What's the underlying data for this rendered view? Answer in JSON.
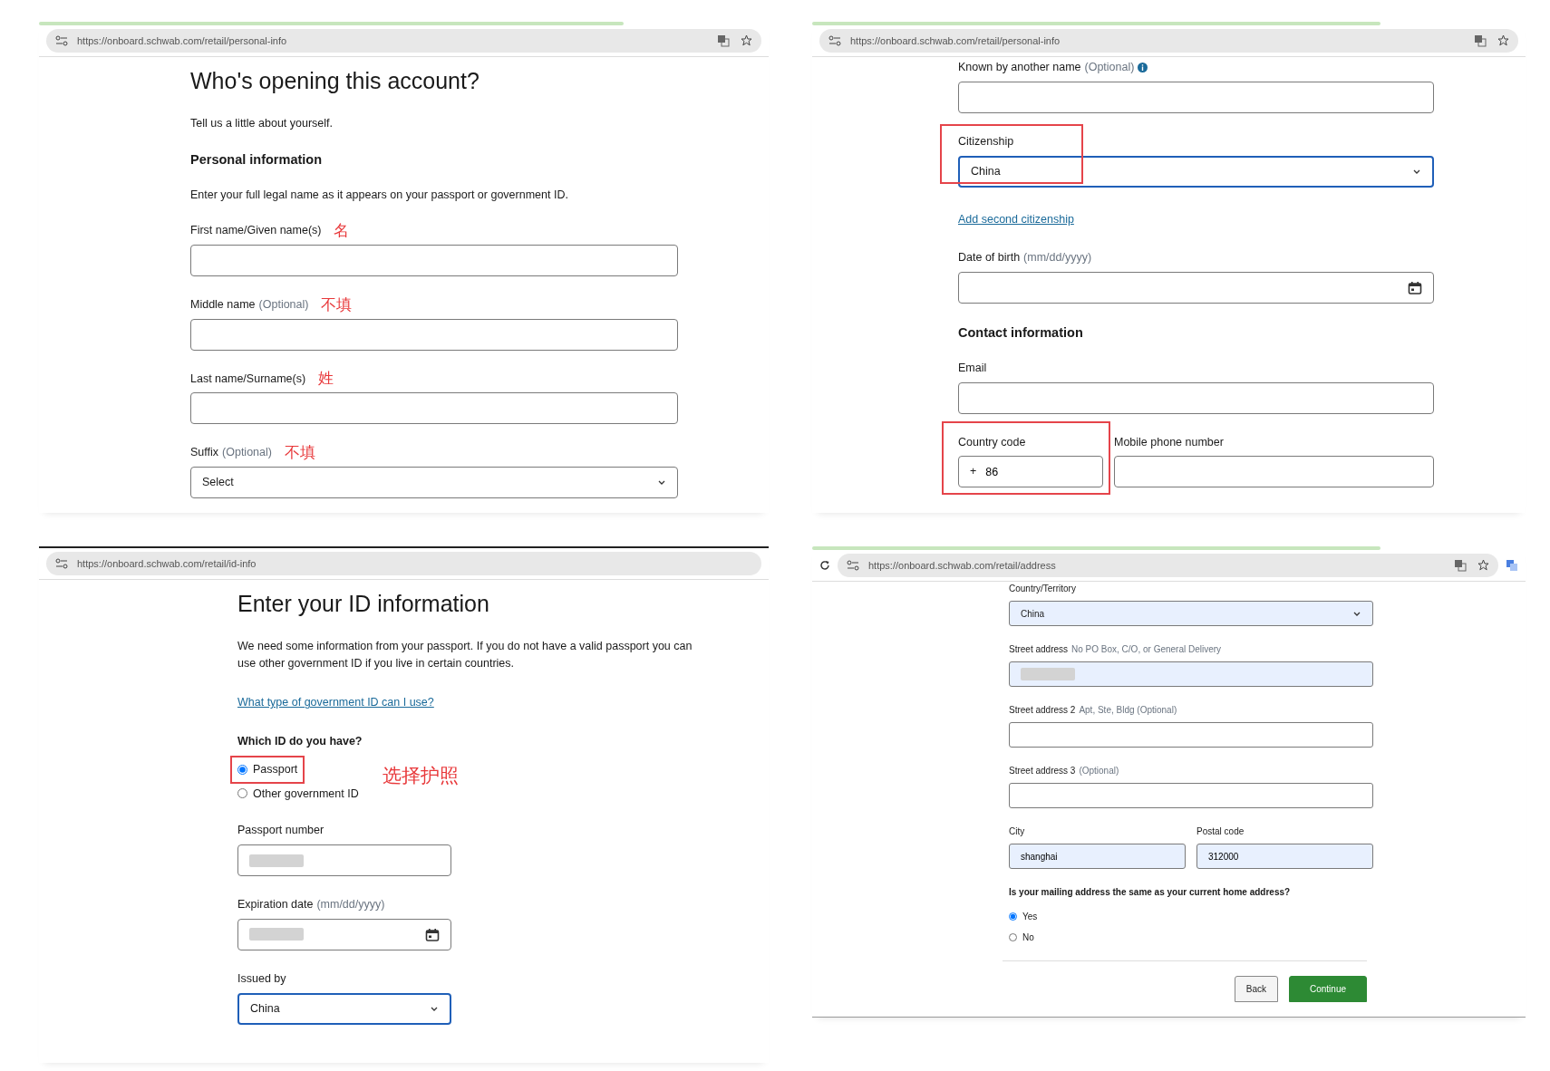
{
  "panels": [
    {
      "url": "https://onboard.schwab.com/retail/personal-info",
      "page_actions": true,
      "reload_button": false,
      "items": [
        {
          "kind": "title",
          "text": "Who's opening this account?"
        },
        {
          "kind": "text",
          "text": "Tell us a little about yourself."
        },
        {
          "kind": "section",
          "text": "Personal information"
        },
        {
          "kind": "text",
          "text": "Enter your full legal name as it appears on your passport or government ID."
        },
        {
          "kind": "field",
          "label": "First name/Given name(s)",
          "note": "名"
        },
        {
          "kind": "field",
          "label": "Middle name",
          "hint": "(Optional)",
          "note": "不填"
        },
        {
          "kind": "field",
          "label": "Last name/Surname(s)",
          "note": "姓"
        },
        {
          "kind": "select",
          "label": "Suffix",
          "hint": "(Optional)",
          "value": "Select",
          "note": "不填",
          "focused": false
        }
      ]
    },
    {
      "url": "https://onboard.schwab.com/retail/personal-info",
      "page_actions": true,
      "reload_button": false,
      "items": [
        {
          "kind": "field",
          "label": "Known by another name",
          "hint": "(Optional)",
          "info": true
        },
        {
          "kind": "select",
          "label": "Citizenship",
          "value": "China",
          "focused": true,
          "highlighted": true
        },
        {
          "kind": "link",
          "text": "Add second citizenship"
        },
        {
          "kind": "date",
          "label": "Date of birth",
          "hint": "(mm/dd/yyyy)"
        },
        {
          "kind": "section",
          "text": "Contact information"
        },
        {
          "kind": "field",
          "label": "Email"
        },
        {
          "kind": "row",
          "items": [
            {
              "kind": "field",
              "label": "Country code",
              "prefix": "+",
              "value": "86",
              "highlighted": true
            },
            {
              "kind": "field",
              "label": "Mobile phone number"
            }
          ]
        }
      ]
    },
    {
      "url": "https://onboard.schwab.com/retail/id-info",
      "page_actions": false,
      "reload_button": false,
      "items": [
        {
          "kind": "title",
          "text": "Enter your ID information"
        },
        {
          "kind": "text",
          "text": "We need some information from your passport. If you do not have a valid passport you can use other government ID if you live in certain countries."
        },
        {
          "kind": "link",
          "text": "What type of government ID can I use?"
        },
        {
          "kind": "radios",
          "label": "Which ID do you have?",
          "note": "选择护照",
          "options": [
            {
              "label": "Passport",
              "selected": true,
              "highlighted": true
            },
            {
              "label": "Other government ID",
              "selected": false,
              "highlighted": false
            }
          ]
        },
        {
          "kind": "field",
          "label": "Passport number",
          "blurred": true
        },
        {
          "kind": "date",
          "label": "Expiration date",
          "hint": "(mm/dd/yyyy)",
          "blurred": true
        },
        {
          "kind": "select",
          "label": "Issued by",
          "value": "China",
          "focused": true
        }
      ]
    },
    {
      "url": "https://onboard.schwab.com/retail/address",
      "page_actions": true,
      "reload_button": true,
      "items": [
        {
          "kind": "select",
          "label": "Country/Territory",
          "value": "China",
          "autofilled": true,
          "focused": false
        },
        {
          "kind": "field",
          "label": "Street address",
          "hint": "No PO Box, C/O, or General Delivery",
          "autofilled": true,
          "blurred": true
        },
        {
          "kind": "field",
          "label": "Street address 2",
          "hint": "Apt, Ste, Bldg (Optional)"
        },
        {
          "kind": "field",
          "label": "Street address 3",
          "hint": "(Optional)"
        },
        {
          "kind": "row",
          "items": [
            {
              "kind": "field",
              "label": "City",
              "value": "shanghai",
              "autofilled": true
            },
            {
              "kind": "field",
              "label": "Postal code",
              "value": "312000",
              "autofilled": true
            }
          ]
        },
        {
          "kind": "radios",
          "label": "Is your mailing address the same as your current home address?",
          "options": [
            {
              "label": "Yes",
              "selected": true,
              "highlighted": false
            },
            {
              "label": "No",
              "selected": false,
              "highlighted": false
            }
          ]
        },
        {
          "kind": "buttons",
          "buttons": [
            {
              "label": "Back",
              "kind": "secondary"
            },
            {
              "label": "Continue",
              "kind": "primary"
            }
          ]
        }
      ]
    }
  ]
}
